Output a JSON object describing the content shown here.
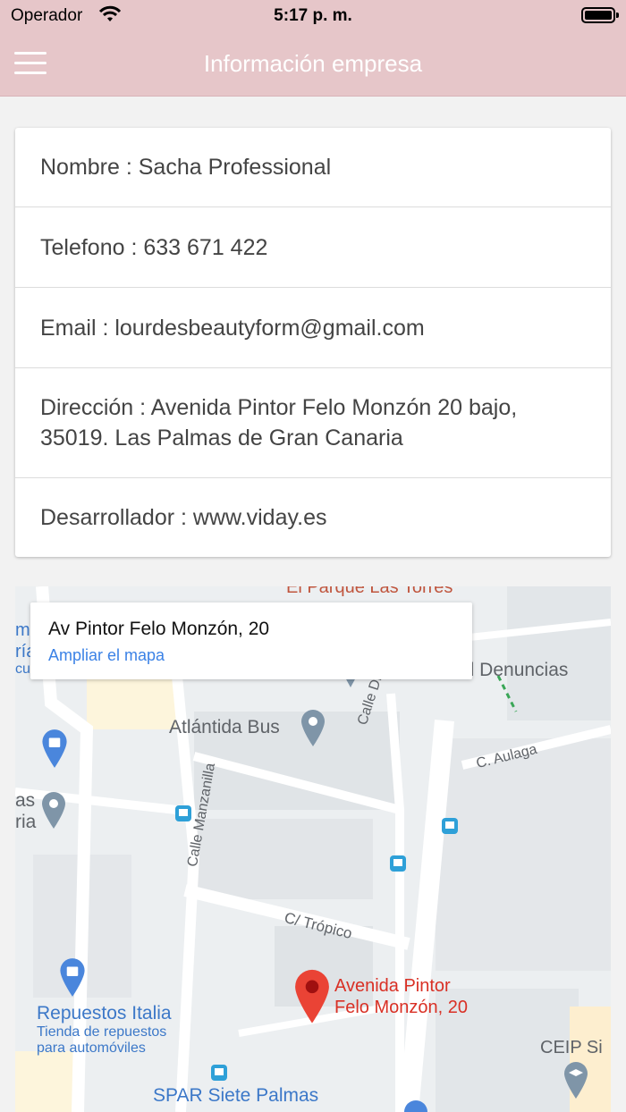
{
  "status_bar": {
    "carrier": "Operador",
    "time": "5:17 p. m."
  },
  "nav": {
    "title": "Información empresa",
    "menu_icon": "hamburger-menu-icon"
  },
  "info": {
    "nombre": "Nombre : Sacha Professional",
    "telefono": "Telefono : 633 671 422",
    "email": "Email : lourdesbeautyform@gmail.com",
    "direccion_1": "Dirección : Avenida Pintor Felo Monzón 20 bajo,",
    "direccion_2": "35019. Las Palmas de Gran Canaria",
    "desarrollador": "Desarrollador : www.viday.es"
  },
  "map": {
    "infobox": {
      "address": "Av Pintor Felo Monzón, 20",
      "link": "Ampliar el mapa"
    },
    "labels": {
      "parque": "El Parque Las Torres",
      "denuncias": "al Denuncias",
      "atlantida": "Atlántida Bus",
      "drago": "Calle Drago",
      "aulaga": "C. Aulaga",
      "manzanilla": "Calle Manzanilla",
      "tropico": "C/ Trópico",
      "pin_1": "Avenida Pintor",
      "pin_2": "Felo Monzón, 20",
      "repuestos": "Repuestos Italia",
      "repuestos_sub_1": "Tienda de repuestos",
      "repuestos_sub_2": "para automóviles",
      "ceip": "CEIP Si",
      "spar": "SPAR Siete Palmas",
      "left_1": "mi",
      "left_2": "ría",
      "left_3": "cul",
      "left_4": "as",
      "left_5": "ria"
    },
    "colors": {
      "pin": "#d93025",
      "poi": "#3c78c8",
      "road": "#ffffff",
      "block": "#dfe3e6"
    }
  }
}
